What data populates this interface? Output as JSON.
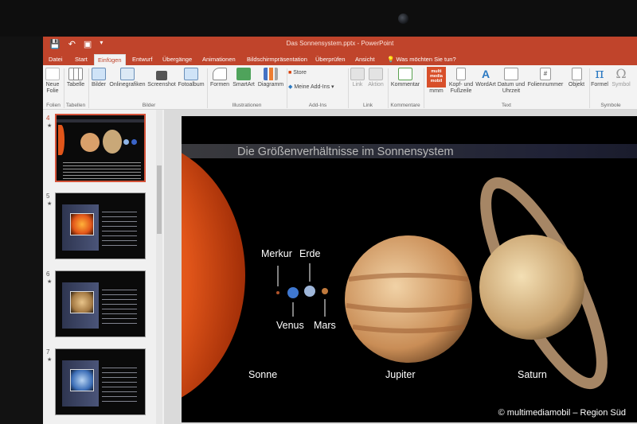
{
  "app": {
    "doc_title": "Das Sonnensystem.pptx - PowerPoint"
  },
  "tabs": [
    "Datei",
    "Start",
    "Einfügen",
    "Entwurf",
    "Übergänge",
    "Animationen",
    "Bildschirmpräsentation",
    "Überprüfen",
    "Ansicht",
    "Was möchten Sie tun?"
  ],
  "active_tab": "Einfügen",
  "ribbon": {
    "buttons": {
      "neue_folie": "Neue Folie",
      "tabelle": "Tabelle",
      "bilder": "Bilder",
      "onlinegrafiken": "Onlinegrafiken",
      "screenshot": "Screenshot",
      "fotoalbum": "Fotoalbum",
      "formen": "Formen",
      "smartart": "SmartArt",
      "diagramm": "Diagramm",
      "store": "Store",
      "meine_addins": "Meine Add-Ins",
      "link": "Link",
      "aktion": "Aktion",
      "kommentar": "Kommentar",
      "mmm": "mmm",
      "kopf_fusszeile": "Kopf- und Fußzeile",
      "wordart": "WordArt",
      "datum_uhrzeit": "Datum und Uhrzeit",
      "foliennummer": "Foliennummer",
      "objekt": "Objekt",
      "formel": "Formel",
      "symbol": "Symbol"
    },
    "groups": {
      "folien": "Folien",
      "tabellen": "Tabellen",
      "bilder": "Bilder",
      "illustrationen": "Illustrationen",
      "addins": "Add-Ins",
      "links": "Link",
      "kommentare": "Kommentare",
      "text": "Text",
      "symbole": "Symbole"
    },
    "mmm_logo_text": "multi media mobil"
  },
  "thumbnails": [
    {
      "number": "4",
      "marker": "★"
    },
    {
      "number": "5",
      "marker": "★"
    },
    {
      "number": "6",
      "marker": "★"
    },
    {
      "number": "7",
      "marker": "★"
    }
  ],
  "slide": {
    "title": "Die Größenverhältnisse im Sonnensystem",
    "labels": {
      "merkur": "Merkur",
      "erde": "Erde",
      "venus": "Venus",
      "mars": "Mars",
      "sonne": "Sonne",
      "jupiter": "Jupiter",
      "saturn": "Saturn"
    }
  },
  "copyright": "© multimediamobil – Region Süd",
  "colors": {
    "accent": "#c0442b",
    "sun": "#e2561a",
    "jupiter": "#d9a06a",
    "saturn": "#dcc098"
  }
}
